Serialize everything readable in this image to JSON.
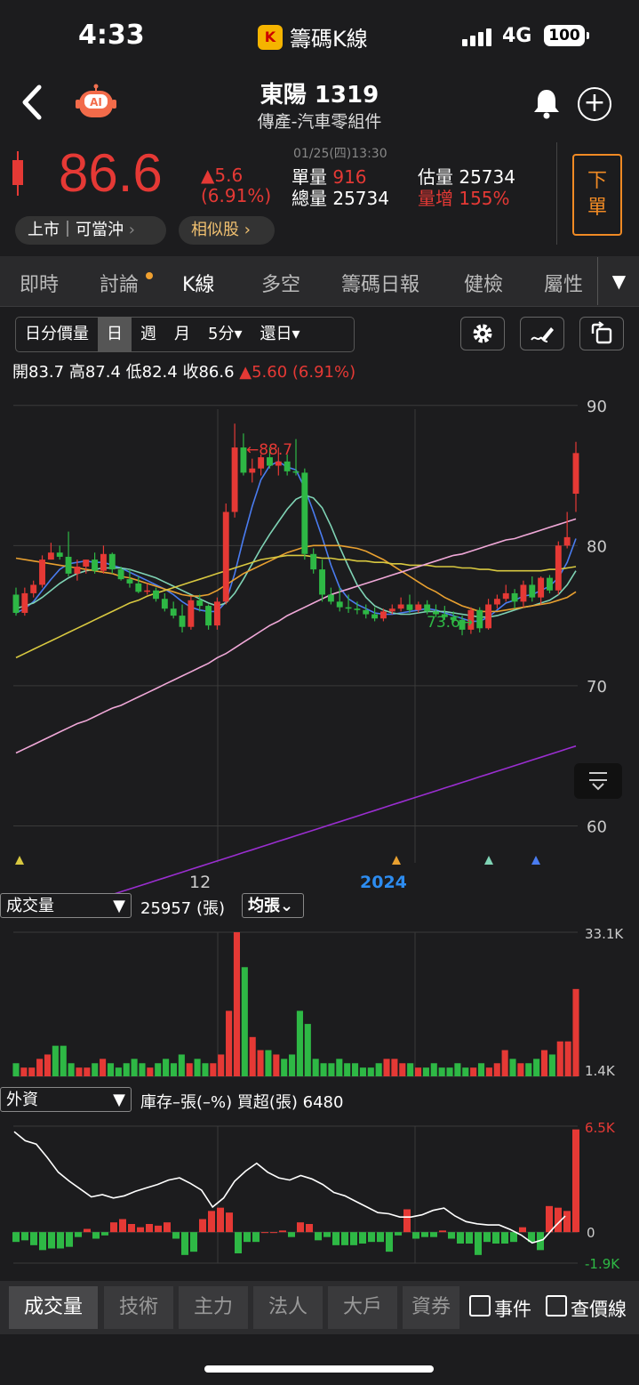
{
  "status_bar": {
    "time": "4:33",
    "app_name": "籌碼K線",
    "network": "4G",
    "battery": "100"
  },
  "header": {
    "title": "東陽 1319",
    "industry": "傳產-汽車零組件"
  },
  "quote": {
    "price": "86.6",
    "change": "▲5.6",
    "change_pct": "(6.91%)",
    "datetime": "01/25(四)13:30",
    "unit_vol_label": "單量",
    "unit_vol": "916",
    "total_vol_label": "總量",
    "total_vol": "25734",
    "est_vol_label": "估量",
    "est_vol": "25734",
    "vol_inc_label": "量增",
    "vol_inc": "155%",
    "sell_label_1": "下",
    "sell_label_2": "單",
    "market_badge": "上市｜可當沖",
    "similar_label": "相似股"
  },
  "tabs": [
    "即時",
    "討論",
    "K線",
    "多空",
    "籌碼日報",
    "健檢",
    "屬性"
  ],
  "active_tab": "K線",
  "period_options": [
    "日分價量",
    "日",
    "週",
    "月",
    "5分▾",
    "還日▾"
  ],
  "ohlc": {
    "open_label": "開",
    "open": "83.7",
    "high_label": "高",
    "high": "87.4",
    "low_label": "低",
    "low": "82.4",
    "close_label": "收",
    "close": "86.6",
    "change": "▲5.60 (6.91%)"
  },
  "chart_data": [
    {
      "type": "candlestick",
      "y_ticks": [
        "90",
        "80",
        "70",
        "60"
      ],
      "ylim": [
        58,
        91
      ],
      "x_labels": [
        "12",
        "2024"
      ],
      "annotations": [
        "←88.7",
        "73.6→"
      ],
      "ohlc": [
        [
          76.5,
          77,
          75,
          75.2
        ],
        [
          75.2,
          77,
          75,
          76.6
        ],
        [
          76.6,
          77.5,
          76.3,
          77.2
        ],
        [
          77.2,
          79.3,
          77,
          79
        ],
        [
          79,
          80.2,
          79,
          79.5
        ],
        [
          79.5,
          80,
          79,
          79.2
        ],
        [
          79.2,
          81,
          77.8,
          78
        ],
        [
          78,
          79,
          77.5,
          78.5
        ],
        [
          78.5,
          79,
          78,
          79
        ],
        [
          79,
          79.5,
          78,
          78.2
        ],
        [
          78.2,
          80,
          78,
          79.4
        ],
        [
          79.4,
          79.5,
          78,
          78.3
        ],
        [
          78.3,
          78.5,
          77.5,
          77.6
        ],
        [
          77.6,
          78.3,
          77,
          77.3
        ],
        [
          77.3,
          77.8,
          76.6,
          76.7
        ],
        [
          76.7,
          77.3,
          76.5,
          76.8
        ],
        [
          76.8,
          77,
          76,
          76.2
        ],
        [
          76.2,
          76.6,
          75.3,
          75.5
        ],
        [
          75.5,
          76,
          74.8,
          75
        ],
        [
          75,
          75.8,
          73.8,
          74.2
        ],
        [
          74.2,
          76.4,
          74,
          76.1
        ],
        [
          76.1,
          76.5,
          75.3,
          75.7
        ],
        [
          75.7,
          75.8,
          74,
          74.3
        ],
        [
          74.3,
          76.3,
          74,
          76
        ],
        [
          76,
          83,
          75.8,
          82.4
        ],
        [
          82.4,
          88.7,
          82,
          87
        ],
        [
          87,
          88,
          85,
          85.2
        ],
        [
          85.2,
          86.2,
          84.5,
          85.5
        ],
        [
          85.5,
          86.5,
          85,
          86.3
        ],
        [
          86.3,
          87,
          85.5,
          85.7
        ],
        [
          85.7,
          87,
          85,
          86
        ],
        [
          86,
          86.5,
          85,
          85.3
        ],
        [
          85.3,
          87.6,
          85,
          85.2
        ],
        [
          85.2,
          85.5,
          79,
          79.4
        ],
        [
          79.4,
          79.8,
          78,
          78.3
        ],
        [
          78.3,
          79,
          76,
          76.5
        ],
        [
          76.5,
          77,
          75.8,
          76
        ],
        [
          76,
          77,
          75.3,
          75.6
        ],
        [
          75.6,
          76.5,
          75.2,
          75.5
        ],
        [
          75.5,
          76,
          75.1,
          75.4
        ],
        [
          75.4,
          75.8,
          74.8,
          75.1
        ],
        [
          75.1,
          75.6,
          74.6,
          74.8
        ],
        [
          74.8,
          75.5,
          74.6,
          75.3
        ],
        [
          75.3,
          75.8,
          75.1,
          75.5
        ],
        [
          75.5,
          76.3,
          75.3,
          75.8
        ],
        [
          75.8,
          76.5,
          75.2,
          75.4
        ],
        [
          75.4,
          76,
          75.2,
          75.8
        ],
        [
          75.8,
          76.1,
          75.1,
          75.3
        ],
        [
          75.3,
          75.8,
          74.9,
          75.1
        ],
        [
          75.1,
          75.7,
          74.7,
          74.9
        ],
        [
          74.9,
          75.3,
          74.5,
          74.7
        ],
        [
          74.7,
          75,
          73.6,
          74
        ],
        [
          74,
          75.6,
          73.7,
          75.4
        ],
        [
          75.4,
          75.6,
          73.8,
          74.1
        ],
        [
          74.1,
          76.2,
          74,
          75.8
        ],
        [
          75.8,
          76.5,
          75.5,
          76.2
        ],
        [
          76.2,
          77.2,
          76,
          76.6
        ],
        [
          76.6,
          76.9,
          75.5,
          76
        ],
        [
          76,
          77.5,
          75.6,
          77.2
        ],
        [
          77.2,
          77.8,
          76,
          76.3
        ],
        [
          76.3,
          77.8,
          75.8,
          77.7
        ],
        [
          77.7,
          77.9,
          76.6,
          76.8
        ],
        [
          76.8,
          80.3,
          76.5,
          80
        ],
        [
          80,
          82.4,
          79.8,
          80.6
        ],
        [
          83.7,
          87.4,
          82.4,
          86.6
        ]
      ],
      "ma_lines": {
        "ma5_blue": [
          75.2,
          75.5,
          76,
          76.8,
          77.6,
          78.3,
          78.7,
          78.8,
          78.9,
          78.8,
          78.8,
          78.6,
          78.4,
          78.1,
          77.8,
          77.5,
          77.2,
          76.9,
          76.5,
          76,
          75.6,
          75.4,
          75.3,
          75.3,
          76,
          78,
          80.5,
          82.8,
          84.7,
          85.7,
          86,
          85.6,
          85.4,
          84.1,
          82.4,
          80.6,
          78.6,
          77,
          76.2,
          75.8,
          75.5,
          75.2,
          75.1,
          75.1,
          75.2,
          75.3,
          75.4,
          75.5,
          75.4,
          75.2,
          75,
          74.8,
          74.6,
          74.6,
          74.9,
          75.4,
          75.9,
          76.1,
          76.4,
          76.5,
          76.8,
          77.1,
          77.7,
          78.8,
          80.5
        ],
        "ma10_teal": [
          75.5,
          75.7,
          75.9,
          76.3,
          76.8,
          77.3,
          77.7,
          78,
          78.2,
          78.3,
          78.4,
          78.4,
          78.4,
          78.3,
          78.1,
          77.9,
          77.7,
          77.4,
          77.1,
          76.8,
          76.5,
          76.2,
          75.9,
          75.7,
          75.9,
          76.6,
          77.6,
          78.7,
          79.8,
          80.8,
          81.7,
          82.6,
          83.3,
          83.6,
          83.4,
          82.7,
          81.4,
          79.9,
          78.5,
          77.2,
          76.3,
          75.7,
          75.4,
          75.2,
          75.1,
          75.1,
          75.2,
          75.3,
          75.3,
          75.3,
          75.2,
          75.1,
          75,
          74.9,
          74.9,
          75,
          75.2,
          75.4,
          75.6,
          75.7,
          75.9,
          76.1,
          76.5,
          77.2,
          78.2
        ],
        "ma20_orange": [
          79.1,
          79,
          78.9,
          78.8,
          78.7,
          78.6,
          78.5,
          78.4,
          78.3,
          78.2,
          78.1,
          78,
          77.8,
          77.7,
          77.5,
          77.3,
          77.1,
          76.9,
          76.7,
          76.5,
          76.4,
          76.4,
          76.5,
          76.8,
          77.2,
          77.6,
          78,
          78.3,
          78.6,
          78.9,
          79.2,
          79.5,
          79.7,
          79.9,
          80,
          80,
          80,
          80,
          79.9,
          79.8,
          79.6,
          79.3,
          79,
          78.6,
          78.2,
          77.8,
          77.4,
          77,
          76.7,
          76.3,
          76,
          75.7,
          75.5,
          75.3,
          75.3,
          75.3,
          75.4,
          75.5,
          75.6,
          75.7,
          75.8,
          75.9,
          76.1,
          76.3,
          76.7
        ],
        "ma60_yellow": [
          72,
          72.3,
          72.6,
          72.9,
          73.2,
          73.5,
          73.8,
          74.1,
          74.4,
          74.7,
          75,
          75.3,
          75.6,
          75.9,
          76.1,
          76.4,
          76.6,
          76.8,
          77,
          77.2,
          77.4,
          77.6,
          77.8,
          78,
          78.2,
          78.4,
          78.6,
          78.8,
          79,
          79.1,
          79.2,
          79.3,
          79.3,
          79.3,
          79.2,
          79.1,
          79.1,
          79,
          79,
          78.9,
          78.9,
          78.8,
          78.8,
          78.7,
          78.7,
          78.6,
          78.6,
          78.6,
          78.5,
          78.5,
          78.5,
          78.4,
          78.4,
          78.3,
          78.3,
          78.2,
          78.2,
          78.2,
          78.2,
          78.2,
          78.2,
          78.3,
          78.3,
          78.4,
          78.5
        ],
        "ma120_pink": [
          65.2,
          65.5,
          65.8,
          66.1,
          66.4,
          66.7,
          67,
          67.3,
          67.5,
          67.8,
          68.1,
          68.4,
          68.6,
          68.9,
          69.2,
          69.5,
          69.8,
          70.1,
          70.4,
          70.7,
          71,
          71.3,
          71.6,
          72,
          72.3,
          72.7,
          73.1,
          73.5,
          73.9,
          74.3,
          74.6,
          75,
          75.3,
          75.6,
          75.9,
          76.2,
          76.5,
          76.7,
          76.9,
          77.1,
          77.3,
          77.5,
          77.7,
          77.9,
          78.1,
          78.3,
          78.5,
          78.7,
          78.9,
          79.1,
          79.3,
          79.4,
          79.6,
          79.8,
          80,
          80.2,
          80.4,
          80.5,
          80.7,
          80.9,
          81.1,
          81.3,
          81.5,
          81.7,
          81.9
        ],
        "ma240_purple": [
          52.9,
          53.1,
          53.3,
          53.5,
          53.7,
          53.9,
          54.1,
          54.3,
          54.5,
          54.7,
          54.9,
          55.1,
          55.3,
          55.5,
          55.7,
          55.9,
          56.1,
          56.3,
          56.5,
          56.7,
          56.9,
          57.1,
          57.3,
          57.5,
          57.7,
          57.9,
          58.1,
          58.3,
          58.5,
          58.7,
          58.9,
          59.1,
          59.3,
          59.5,
          59.7,
          59.9,
          60.1,
          60.3,
          60.5,
          60.7,
          60.9,
          61.1,
          61.3,
          61.5,
          61.7,
          61.9,
          62.1,
          62.3,
          62.5,
          62.7,
          62.9,
          63.1,
          63.3,
          63.5,
          63.7,
          63.9,
          64.1,
          64.3,
          64.5,
          64.7,
          64.9,
          65.1,
          65.3,
          65.5,
          65.7
        ]
      }
    },
    {
      "type": "bar",
      "title": "成交量",
      "y_ticks": [
        "33.1K",
        "1.4K"
      ],
      "values": [
        3,
        2,
        2,
        4,
        5,
        7,
        7,
        3,
        2,
        2,
        3,
        4,
        3,
        2,
        3,
        4,
        3,
        2,
        3,
        4,
        3,
        5,
        3,
        4,
        3,
        3,
        5,
        15,
        33,
        25,
        9,
        6,
        6,
        5,
        4,
        5,
        15,
        12,
        4,
        3,
        3,
        4,
        3,
        3,
        2,
        2,
        3,
        4,
        4,
        3,
        3,
        2,
        2,
        3,
        2,
        2,
        3,
        2,
        2,
        3,
        2,
        3,
        6,
        4,
        3,
        3,
        4,
        6,
        5,
        8,
        8,
        20
      ],
      "label": "25957 (張)",
      "avg_label": "均張⌄"
    },
    {
      "type": "bar+line",
      "title": "外資",
      "info": "庫存–張(–%)  買超(張) 6480",
      "y_ticks": [
        "6.5K",
        "0",
        "-1.9K"
      ],
      "buy_sell": [
        -0.6,
        -0.5,
        -0.8,
        -1.1,
        -1,
        -1,
        -0.9,
        -0.3,
        0.2,
        -0.4,
        -0.2,
        0.6,
        0.8,
        0.5,
        0.3,
        0.5,
        0.4,
        0.6,
        -0.4,
        -1.4,
        -1.2,
        0.8,
        1.3,
        1.5,
        1.2,
        -1.3,
        -0.6,
        -0.6,
        0,
        0,
        0.1,
        -0.3,
        0.6,
        0.5,
        -0.5,
        -0.3,
        -0.8,
        -0.8,
        -0.8,
        -0.7,
        -0.6,
        -0.6,
        -1.2,
        -0.2,
        1.4,
        -0.4,
        -0.3,
        -0.3,
        0.1,
        -0.4,
        -0.7,
        -0.7,
        -1.4,
        -0.6,
        -0.7,
        -0.7,
        -0.6,
        0.3,
        -0.6,
        -1.1,
        1.6,
        1.5,
        1.3,
        6.3
      ],
      "holdings_line": [
        11.7,
        10.9,
        10.6,
        9.4,
        8.1,
        7.3,
        6.6,
        5.9,
        6.1,
        5.8,
        6.0,
        6.4,
        6.7,
        7.0,
        7.4,
        7.6,
        7.1,
        6.5,
        5.0,
        5.8,
        7.3,
        8.2,
        8.9,
        8.1,
        7.6,
        7.4,
        7.8,
        7.5,
        7.0,
        6.3,
        6.0,
        5.5,
        5.0,
        4.5,
        4.4,
        4.1,
        4.1,
        4.3,
        4.7,
        4.9,
        4.2,
        3.7,
        3.5,
        3.4,
        3.4,
        3.0,
        2.5,
        1.8,
        2.1,
        3.2,
        4.2
      ]
    }
  ],
  "volume_selector": "成交量",
  "volume_info": "25957 (張)",
  "volume_avg_btn": "均張",
  "foreign_selector": "外資",
  "foreign_info": "庫存–張(–%)  買超(張) 6480",
  "bottom_tabs": [
    "成交量",
    "技術",
    "主力",
    "法人",
    "大戶",
    "資券"
  ],
  "checkboxes": [
    "事件",
    "查價線"
  ],
  "colors": {
    "up": "#e53935",
    "down": "#2eb845",
    "accent_orange": "#f08a24",
    "highlight_blue": "#2d8cf0"
  }
}
